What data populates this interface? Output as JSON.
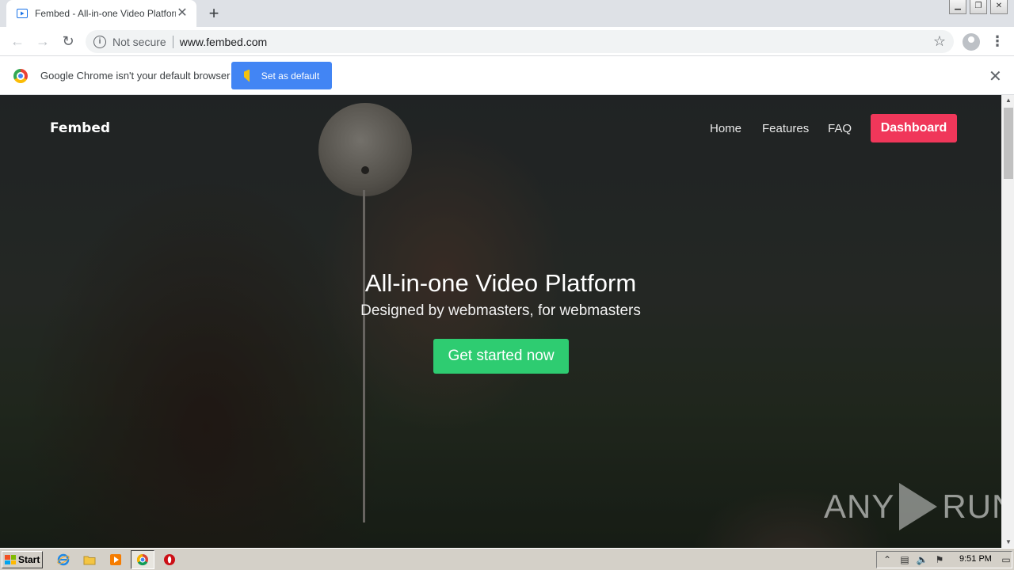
{
  "browser": {
    "tab_title": "Fembed - All-in-one Video Platform",
    "tab_close": "✕",
    "new_tab": "+",
    "security_label": "Not secure",
    "url": "www.fembed.com",
    "window_controls": [
      "▁",
      "❐",
      "✕"
    ]
  },
  "infobar": {
    "message": "Google Chrome isn't your default browser",
    "button_label": "Set as default",
    "close": "✕"
  },
  "page": {
    "brand": "Fembed",
    "nav": [
      "Home",
      "Features",
      "FAQ"
    ],
    "dashboard_label": "Dashboard",
    "hero_title": "All-in-one Video Platform",
    "hero_subtitle": "Designed by webmasters, for webmasters",
    "cta_label": "Get started now",
    "watermark_left": "ANY",
    "watermark_right": "RUN",
    "accent_dashboard": "#f0375a",
    "accent_cta": "#2ecc71"
  },
  "taskbar": {
    "start_label": "Start",
    "clock": "9:51 PM",
    "icons": [
      "internet-explorer-icon",
      "folder-icon",
      "media-player-icon",
      "chrome-icon",
      "opera-icon"
    ]
  }
}
